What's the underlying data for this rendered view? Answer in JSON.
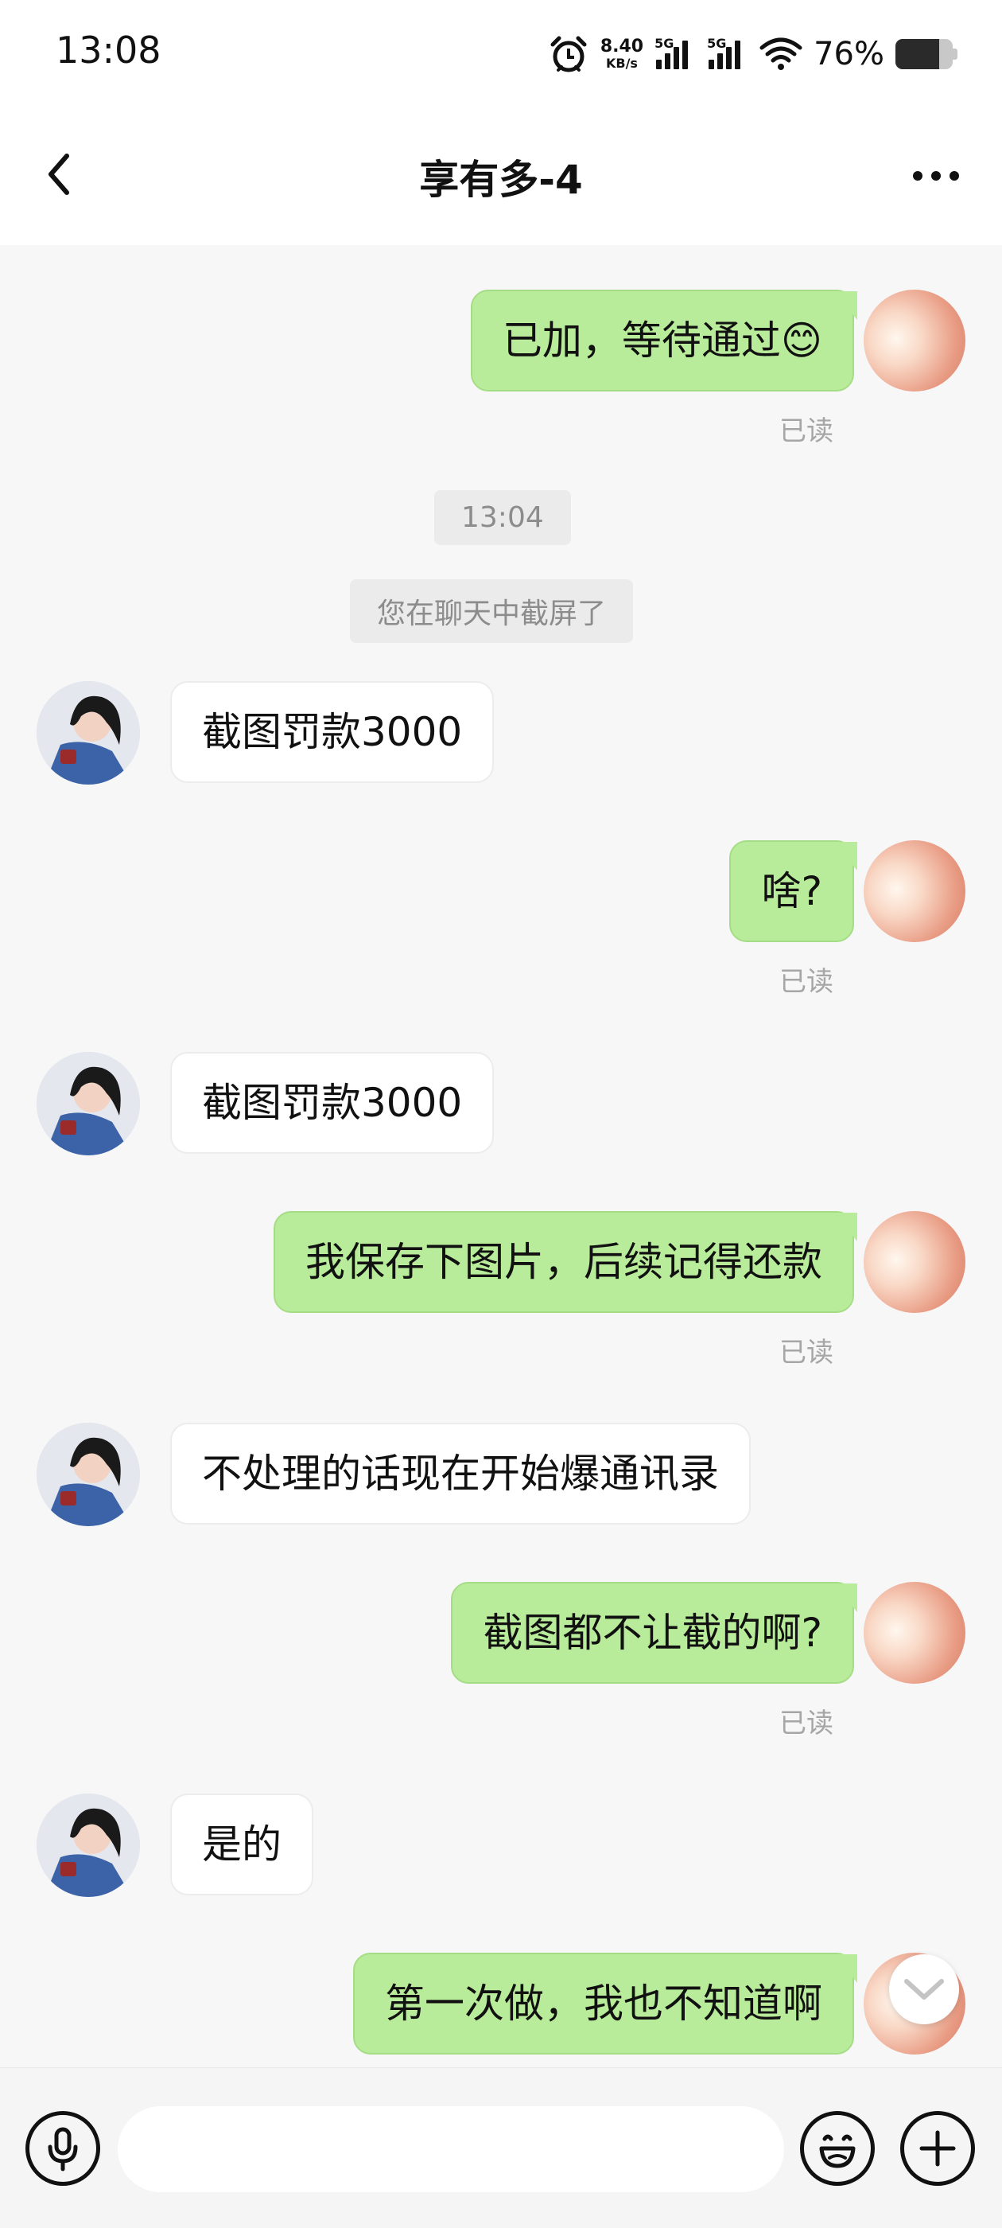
{
  "status_bar": {
    "time": "13:08",
    "net_speed_value": "8.40",
    "net_speed_unit": "KB/s",
    "signal_1_label": "5G",
    "signal_2_label": "5G",
    "battery_percent": "76%",
    "battery_level": 0.76
  },
  "header": {
    "title": "享有多-4",
    "back_icon": "chevron-left-icon",
    "more_icon": "more-horizontal-icon"
  },
  "messages": [
    {
      "side": "me",
      "text": "已加，等待通过😊",
      "read_label": "已读"
    },
    {
      "side": "them",
      "text": "截图罚款3000"
    },
    {
      "side": "me",
      "text": "啥?",
      "read_label": "已读"
    },
    {
      "side": "them",
      "text": "截图罚款3000"
    },
    {
      "side": "me",
      "text": "我保存下图片，后续记得还款",
      "read_label": "已读"
    },
    {
      "side": "them",
      "text": "不处理的话现在开始爆通讯录"
    },
    {
      "side": "me",
      "text": "截图都不让截的啊?",
      "read_label": "已读"
    },
    {
      "side": "them",
      "text": "是的"
    },
    {
      "side": "me",
      "text": "第一次做，我也不知道啊"
    }
  ],
  "system": {
    "timestamp": "13:04",
    "screenshot_notice": "您在聊天中截屏了"
  },
  "input_bar": {
    "placeholder": "",
    "voice_icon": "microphone-icon",
    "emoji_icon": "smiley-icon",
    "plus_icon": "plus-icon"
  },
  "colors": {
    "my_bubble": "#b9ec9a",
    "their_bubble": "#ffffff",
    "background": "#f7f7f7",
    "read_text": "#a6a6a6"
  }
}
